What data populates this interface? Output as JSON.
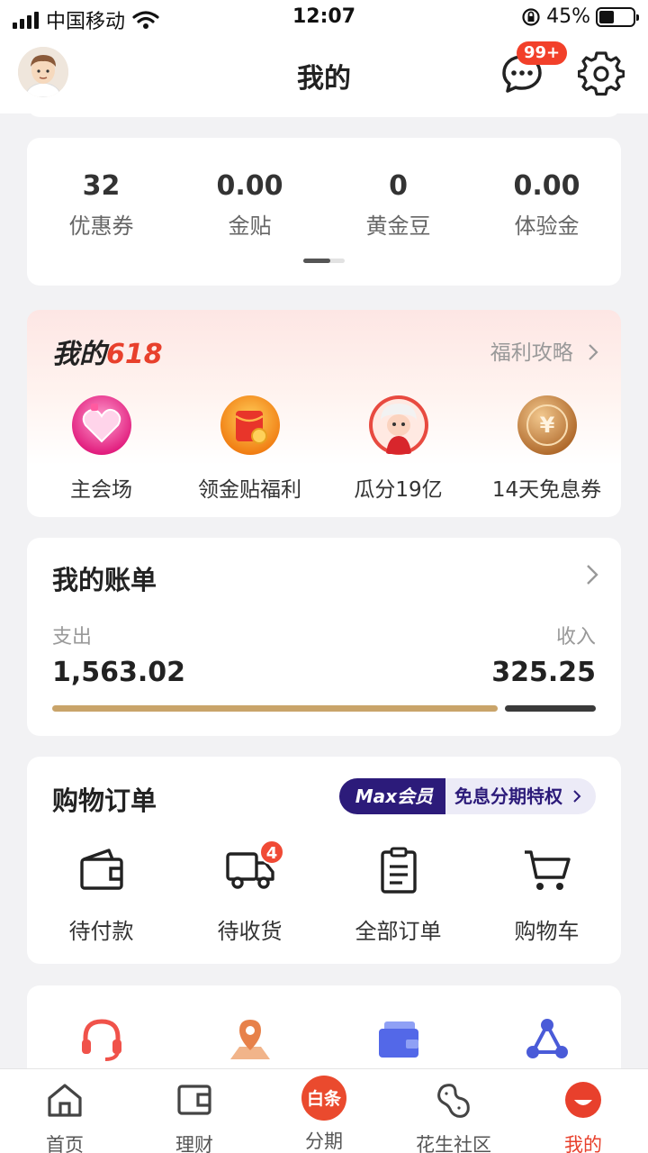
{
  "status_bar": {
    "carrier": "中国移动",
    "time": "12:07",
    "battery": "45%"
  },
  "header": {
    "title": "我的",
    "message_badge": "99+"
  },
  "assets": [
    {
      "value": "32",
      "label": "优惠券"
    },
    {
      "value": "0.00",
      "label": "金贴"
    },
    {
      "value": "0",
      "label": "黄金豆"
    },
    {
      "value": "0.00",
      "label": "体验金"
    }
  ],
  "promo": {
    "title_prefix": "我的",
    "title_highlight": "618",
    "link": "福利攻略",
    "items": [
      {
        "label": "主会场",
        "icon": "heart-gift-icon"
      },
      {
        "label": "领金贴福利",
        "icon": "red-envelope-icon"
      },
      {
        "label": "瓜分19亿",
        "icon": "mascot-icon"
      },
      {
        "label": "14天免息券",
        "icon": "coin-coupon-icon"
      }
    ]
  },
  "bill": {
    "title": "我的账单",
    "expense_label": "支出",
    "income_label": "收入",
    "expense": "1,563.02",
    "income": "325.25",
    "expense_share": 0.83
  },
  "orders": {
    "title": "购物订单",
    "max_badge": "Max会员",
    "max_link": "免息分期特权",
    "items": [
      {
        "label": "待付款",
        "icon": "wallet-icon"
      },
      {
        "label": "待收货",
        "icon": "truck-icon",
        "badge": "4"
      },
      {
        "label": "全部订单",
        "icon": "clipboard-icon"
      },
      {
        "label": "购物车",
        "icon": "cart-icon"
      }
    ]
  },
  "services": [
    {
      "icon": "headset-icon"
    },
    {
      "icon": "location-pin-icon"
    },
    {
      "icon": "card-wallet-icon"
    },
    {
      "icon": "share-network-icon"
    }
  ],
  "tabbar": {
    "items": [
      {
        "label": "首页",
        "icon": "home-icon"
      },
      {
        "label": "理财",
        "icon": "wallet-icon"
      },
      {
        "label": "分期",
        "icon": "baitiao-icon",
        "icon_text": "白条"
      },
      {
        "label": "花生社区",
        "icon": "peanut-icon"
      },
      {
        "label": "我的",
        "icon": "profile-icon"
      }
    ],
    "active": "我的"
  },
  "colors": {
    "accent": "#e8402c",
    "gold": "#c9a46a",
    "max_purple": "#2c1b7a",
    "background": "#f2f2f4"
  }
}
